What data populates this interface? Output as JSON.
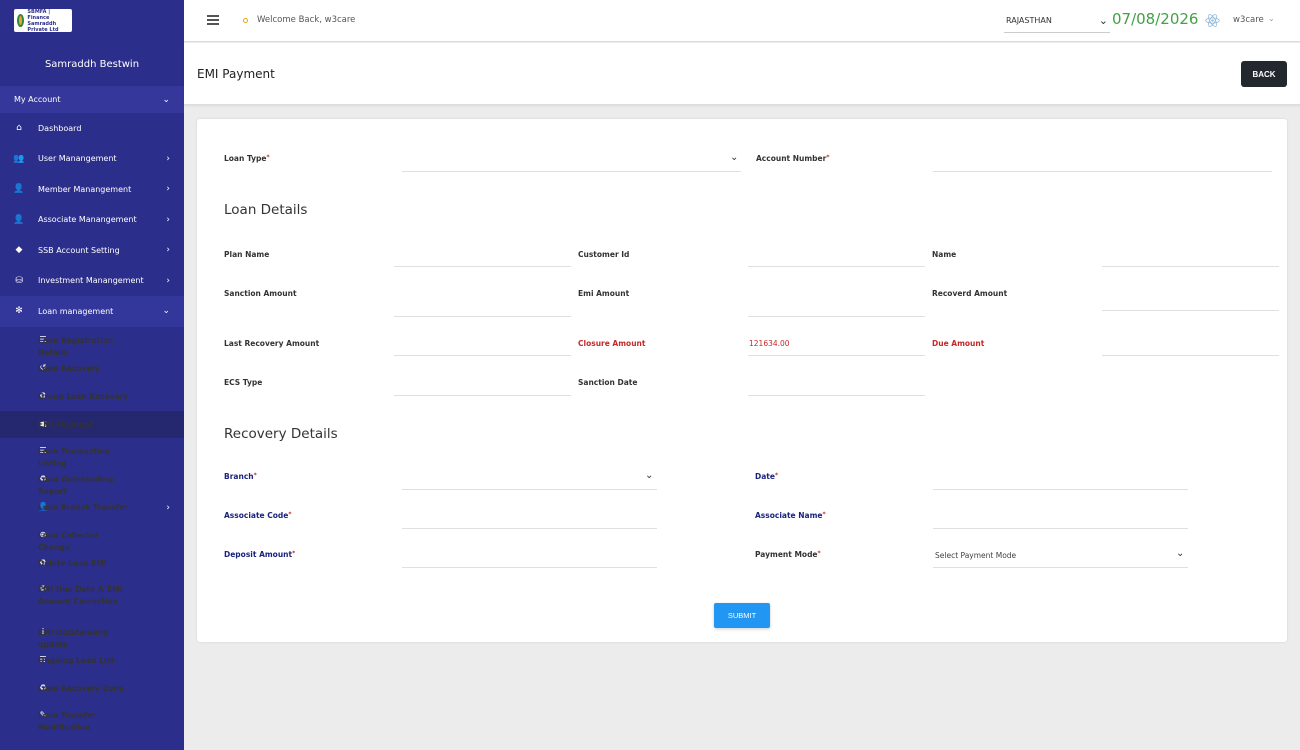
{
  "sidebar": {
    "logo_text": "SBMFA | Finance Samraddh Private Ltd",
    "company": "Samraddh Bestwin",
    "account": "My Account",
    "menu": [
      {
        "label": "Dashboard",
        "icon": "home-icon",
        "has_children": false
      },
      {
        "label": "User Manangement",
        "icon": "users-icon",
        "has_children": true
      },
      {
        "label": "Member Manangement",
        "icon": "user-icon",
        "has_children": true
      },
      {
        "label": "Associate Manangement",
        "icon": "user-tie-icon",
        "has_children": true
      },
      {
        "label": "SSB Account Setting",
        "icon": "piggy-bank-icon",
        "has_children": true
      },
      {
        "label": "Investment Manangement",
        "icon": "coins-icon",
        "has_children": true
      },
      {
        "label": "Loan management",
        "icon": "snowflake-icon",
        "has_children": true,
        "expanded": true
      }
    ],
    "submenu": [
      {
        "label": "Loan Registration Details",
        "icon": "list-icon"
      },
      {
        "label": "Loan Recovery",
        "icon": "undo-icon"
      },
      {
        "label": "Group Loan Recovery",
        "icon": "recycle-icon"
      },
      {
        "label": "EMI Payment",
        "icon": "money-bill-icon",
        "active": true
      },
      {
        "label": "Loan Transaction Listing",
        "icon": "list-icon"
      },
      {
        "label": "Loan Outstanding Report",
        "icon": "recycle-icon"
      },
      {
        "label": "Loan Branch Transfer",
        "icon": "user-icon",
        "has_children": true
      },
      {
        "label": "Loan Collector Change",
        "icon": "plus-circle-icon"
      },
      {
        "label": "Delete Loan EMI",
        "icon": "recycle-icon"
      },
      {
        "label": "EMI Due Date & EMI Amount Correction",
        "icon": "recycle-icon"
      },
      {
        "label": "EMI Outstanding update",
        "icon": "user-upload-icon"
      },
      {
        "label": "Ongoing Loan List",
        "icon": "list-icon"
      },
      {
        "label": "Loan Recovery Zone",
        "icon": "recycle-icon"
      },
      {
        "label": "Loan Transfer Modification",
        "icon": "user-edit-icon"
      }
    ]
  },
  "topbar": {
    "welcome": "Welcome Back, w3care",
    "state": "RAJASTHAN",
    "date": "07/08/2026",
    "user": "w3care"
  },
  "header": {
    "title": "EMI Payment",
    "back_label": "BACK"
  },
  "form": {
    "loan_type_label": "Loan Type",
    "account_number_label": "Account Number",
    "loan_details_title": "Loan Details",
    "plan_name_label": "Plan Name",
    "customer_id_label": "Customer Id",
    "name_label": "Name",
    "sanction_amount_label": "Sanction Amount",
    "emi_amount_label": "Emi Amount",
    "recoverd_amount_label": "Recoverd Amount",
    "last_recovery_label": "Last Recovery Amount",
    "closure_amount_label": "Closure Amount",
    "closure_amount_value": "121634.00",
    "due_amount_label": "Due Amount",
    "ecs_type_label": "ECS Type",
    "sanction_date_label": "Sanction Date",
    "recovery_details_title": "Recovery Details",
    "branch_label": "Branch",
    "date_label": "Date",
    "associate_code_label": "Associate Code",
    "associate_name_label": "Associate Name",
    "deposit_amount_label": "Deposit Amount",
    "payment_mode_label": "Payment Mode",
    "payment_mode_placeholder": "Select Payment Mode",
    "submit_label": "SUBMIT"
  },
  "colors": {
    "sidebar": "#2c2e8b",
    "date_green": "#43a047",
    "required_red": "#c62828",
    "label_blue": "#1a237e",
    "submit_blue": "#2196f3"
  }
}
